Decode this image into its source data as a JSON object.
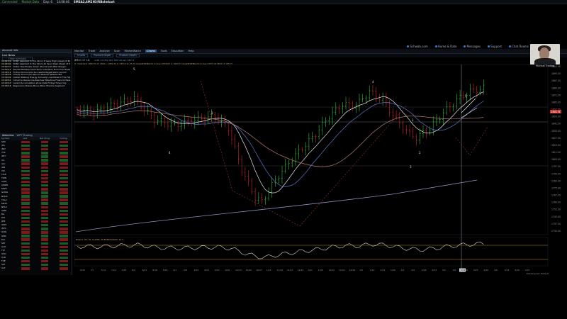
{
  "topbar": {
    "left_items": [
      "Connected",
      "Market Data",
      "Day: 6",
      "14:08:46"
    ],
    "symbol": "SMSA2,6M2H3/RBolmkart"
  },
  "links": [
    "Schwab.com",
    "Hume & Rate",
    "Messages",
    "Support",
    "Chat Rooms"
  ],
  "webcam": {
    "name": "Michael Trading"
  },
  "left_panel": {
    "section_title": "Account Info",
    "live_news_tab": "Live News",
    "filter_text": "Filter symbols",
    "news": [
      {
        "time": "14:02:59",
        "text": "SONY Awarded In The Stock 3 Years High Ahead Of Mo"
      },
      {
        "time": "14:00:00",
        "text": "SONY Awarded In The Stock All Years High Ahead of Mo"
      },
      {
        "time": "13:59:37",
        "text": "Dollar Tree Breaks Down Stocks Sold After Merger"
      },
      {
        "time": "13:54:21",
        "text": "Pandas Release Short-Term Indicators Economic News"
      },
      {
        "time": "13:45:12",
        "text": "Flotner Announces Successful Registration Launch"
      },
      {
        "time": "13:36:28",
        "text": "Oracle Announces Record Results Release Bid"
      },
      {
        "time": "13:34:09",
        "text": "Global Walking Energy Annually Line Notes In The Fall"
      },
      {
        "time": "13:29:52",
        "text": "Cimarron Resources Reaches Milestone Financial News"
      },
      {
        "time": "13:22:40",
        "text": "Lazard Accumulation Zone Date Fridays Financing"
      },
      {
        "time": "13:18:16",
        "text": "Regeneron Shares Move Other Pharma Segment"
      }
    ],
    "watchlist_tabs": [
      "Watchlist",
      "WPT Trading"
    ],
    "watchlist_columns": [
      "Symbol",
      "Last",
      "Net Chng",
      "%Chng"
    ],
    "watchlist": [
      {
        "sym": "SPX",
        "c1": "#7a1a1a",
        "c2": "#7a1a1a",
        "c3": "#7a1a1a"
      },
      {
        "sym": "/ES",
        "c1": "#1e5c24",
        "c2": "#1e5c24",
        "c3": "#1e5c24"
      },
      {
        "sym": "/NQ",
        "c1": "#7a1a1a",
        "c2": "#7a1a1a",
        "c3": "#7a1a1a"
      },
      {
        "sym": "/YM",
        "c1": "#1e5c24",
        "c2": "#1e5c24",
        "c3": "#1e5c24"
      },
      {
        "sym": "/RTY",
        "c1": "#7a1a1a",
        "c2": "#1e5c24",
        "c3": "#7a1a1a"
      },
      {
        "sym": "/CL",
        "c1": "#1e5c24",
        "c2": "#1e5c24",
        "c3": "#1e5c24"
      },
      {
        "sym": "/GC",
        "c1": "#7a1a1a",
        "c2": "#7a1a1a",
        "c3": "#7a1a1a"
      },
      {
        "sym": "/ZB",
        "c1": "#7a1a1a",
        "c2": "#7a1a1a",
        "c3": "#7a1a1a"
      },
      {
        "sym": "VIX",
        "c1": "#1e5c24",
        "c2": "#1e5c24",
        "c3": "#1e5c24"
      },
      {
        "sym": "TICK",
        "c1": "#7a1a1a",
        "c2": "#7a1a1a",
        "c3": "#7a1a1a"
      },
      {
        "sym": "TRIN",
        "c1": "#1e5c24",
        "c2": "#7a1a1a",
        "c3": "#1e5c24"
      },
      {
        "sym": "AAPL",
        "c1": "#7a1a1a",
        "c2": "#7a1a1a",
        "c3": "#7a1a1a"
      },
      {
        "sym": "AMZN",
        "c1": "#1e5c24",
        "c2": "#1e5c24",
        "c3": "#1e5c24"
      },
      {
        "sym": "MSFT",
        "c1": "#7a1a1a",
        "c2": "#7a1a1a",
        "c3": "#7a1a1a"
      },
      {
        "sym": "GOOG",
        "c1": "#7a1a1a",
        "c2": "#1e5c24",
        "c3": "#7a1a1a"
      },
      {
        "sym": "NVDA",
        "c1": "#1e5c24",
        "c2": "#1e5c24",
        "c3": "#1e5c24"
      },
      {
        "sym": "TSLA",
        "c1": "#7a1a1a",
        "c2": "#7a1a1a",
        "c3": "#7a1a1a"
      },
      {
        "sym": "META",
        "c1": "#1e5c24",
        "c2": "#1e5c24",
        "c3": "#1e5c24"
      },
      {
        "sym": "NFLX",
        "c1": "#7a1a1a",
        "c2": "#7a1a1a",
        "c3": "#7a1a1a"
      },
      {
        "sym": "AMD",
        "c1": "#1e5c24",
        "c2": "#7a1a1a",
        "c3": "#1e5c24"
      },
      {
        "sym": "BA",
        "c1": "#7a1a1a",
        "c2": "#7a1a1a",
        "c3": "#7a1a1a"
      },
      {
        "sym": "DIS",
        "c1": "#1e5c24",
        "c2": "#1e5c24",
        "c3": "#1e5c24"
      },
      {
        "sym": "JPM",
        "c1": "#7a1a1a",
        "c2": "#7a1a1a",
        "c3": "#7a1a1a"
      },
      {
        "sym": "XOM",
        "c1": "#1e5c24",
        "c2": "#1e5c24",
        "c3": "#1e5c24"
      },
      {
        "sym": "INTC",
        "c1": "#7a1a1a",
        "c2": "#1e5c24",
        "c3": "#7a1a1a"
      },
      {
        "sym": "QQQ",
        "c1": "#7a1a1a",
        "c2": "#7a1a1a",
        "c3": "#7a1a1a"
      },
      {
        "sym": "IWM",
        "c1": "#1e5c24",
        "c2": "#1e5c24",
        "c3": "#1e5c24"
      },
      {
        "sym": "DIA",
        "c1": "#7a1a1a",
        "c2": "#7a1a1a",
        "c3": "#7a1a1a"
      },
      {
        "sym": "SPY",
        "c1": "#1e5c24",
        "c2": "#1e5c24",
        "c3": "#1e5c24"
      },
      {
        "sym": "GLD",
        "c1": "#7a1a1a",
        "c2": "#7a1a1a",
        "c3": "#7a1a1a"
      },
      {
        "sym": "TLT",
        "c1": "#1e5c24",
        "c2": "#7a1a1a",
        "c3": "#1e5c24"
      },
      {
        "sym": "USO",
        "c1": "#7a1a1a",
        "c2": "#7a1a1a",
        "c3": "#7a1a1a"
      },
      {
        "sym": "UUP",
        "c1": "#1e5c24",
        "c2": "#1e5c24",
        "c3": "#1e5c24"
      },
      {
        "sym": "FXE",
        "c1": "#7a1a1a",
        "c2": "#7a1a1a",
        "c3": "#7a1a1a"
      },
      {
        "sym": "SLV",
        "c1": "#1e5c24",
        "c2": "#1e5c24",
        "c3": "#1e5c24"
      },
      {
        "sym": "XLF",
        "c1": "#7a1a1a",
        "c2": "#7a1a1a",
        "c3": "#7a1a1a"
      }
    ]
  },
  "main": {
    "menu": [
      "Monitor",
      "Trade",
      "Analyze",
      "Scan",
      "MarketWatch",
      "Charts",
      "Tools",
      "Education",
      "Help"
    ],
    "active_menu": "Charts",
    "subtabs": [
      "Charts",
      "Product Depth",
      "Product Depth"
    ],
    "symbol_label": "/ES",
    "timeframe": "D 1Y 1D",
    "study_line": "D: 3/24/14  O: 1880.75  H: 1882  L: 1856.75  C: 1857.5  R: 25.25   UpperRSISMA(20,2,close)  1879.03   S: 1900.77   UpperRSIEMA(20,2,close)  1872.14  1891.17  1853.5",
    "study_line2": "-0.88 (-0.15%)  Bid: 1857.25  Ask: 1857.5",
    "subchart_label": "RSI(14, 30, 70, CLOSE)  36.86585  MACD 14.7",
    "wave_labels": [
      "5",
      "3",
      "4",
      "4",
      "3",
      "1",
      "2",
      "5"
    ],
    "price_ticks": [
      "1902.50",
      "1895.00",
      "1887.50",
      "1880.00",
      "1872.50",
      "1865.00",
      "1857.50",
      "1850.00",
      "1842.50",
      "1835.00",
      "1827.50",
      "1820.00",
      "1812.50",
      "1805.00",
      "1797.50",
      "1790.00",
      "1782.50",
      "1775.00",
      "1767.50",
      "1760.00",
      "1752.50",
      "1745.00",
      "1737.50",
      "1730.00"
    ],
    "last_price_tag": "1858.75",
    "date_ticks": [
      "6/30",
      "7/7",
      "7/14",
      "7/21",
      "7/28",
      "8/4",
      "8/11",
      "8/18",
      "8/25",
      "9/1",
      "9/8",
      "9/15",
      "9/22",
      "9/29",
      "10/6",
      "10/13",
      "10/20",
      "10/27",
      "11/3",
      "11/10",
      "11/17",
      "11/24",
      "12/1",
      "12/8",
      "12/15",
      "12/22",
      "12/29",
      "1/5",
      "1/12",
      "1/19",
      "1/26",
      "2/2",
      "2/9",
      "2/16",
      "2/23",
      "3/2",
      "3/9",
      "3/16",
      "3/23",
      "3/30",
      "4/6",
      "4/13",
      "4/20",
      "4/27"
    ],
    "current_date_tag": "3/24",
    "drawing_set": "Drawing set: Default"
  }
}
